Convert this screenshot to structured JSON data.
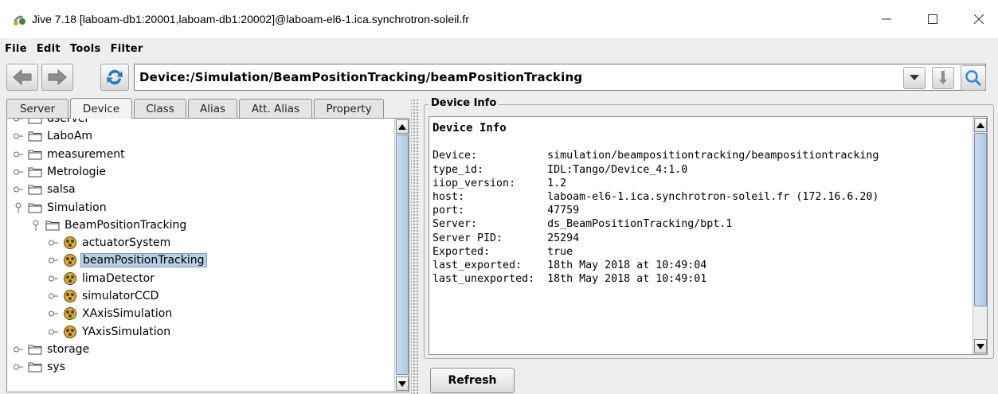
{
  "window": {
    "title": "Jive 7.18 [laboam-db1:20001,laboam-db1:20002]@laboam-el6-1.ica.synchrotron-soleil.fr",
    "controls": [
      "minimize",
      "maximize",
      "close"
    ]
  },
  "menu": [
    "File",
    "Edit",
    "Tools",
    "Filter"
  ],
  "toolbar": {
    "path": "Device:/Simulation/BeamPositionTracking/beamPositionTracking",
    "icons": [
      "back-arrow-icon",
      "forward-arrow-icon",
      "refresh-icon",
      "dropdown-arrow-icon",
      "go-down-icon",
      "search-icon"
    ]
  },
  "tabs": [
    "Server",
    "Device",
    "Class",
    "Alias",
    "Att. Alias",
    "Property"
  ],
  "active_tab": "Device",
  "tree": [
    {
      "label": "dserver",
      "type": "folder",
      "level": 0
    },
    {
      "label": "LaboAm",
      "type": "folder",
      "level": 0
    },
    {
      "label": "measurement",
      "type": "folder",
      "level": 0
    },
    {
      "label": "Metrologie",
      "type": "folder",
      "level": 0
    },
    {
      "label": "salsa",
      "type": "folder",
      "level": 0
    },
    {
      "label": "Simulation",
      "type": "folder",
      "level": 0,
      "expanded": true
    },
    {
      "label": "BeamPositionTracking",
      "type": "folder",
      "level": 1,
      "expanded": true
    },
    {
      "label": "actuatorSystem",
      "type": "device",
      "level": 2
    },
    {
      "label": "beamPositionTracking",
      "type": "device",
      "level": 2,
      "selected": true
    },
    {
      "label": "limaDetector",
      "type": "device",
      "level": 2
    },
    {
      "label": "simulatorCCD",
      "type": "device",
      "level": 2
    },
    {
      "label": "XAxisSimulation",
      "type": "device",
      "level": 2
    },
    {
      "label": "YAxisSimulation",
      "type": "device",
      "level": 2
    },
    {
      "label": "storage",
      "type": "folder",
      "level": 0
    },
    {
      "label": "sys",
      "type": "folder",
      "level": 0
    }
  ],
  "device_info": {
    "group_title": "Device Info",
    "heading": "Device Info",
    "fields": [
      {
        "key": "Device:",
        "value": "simulation/beampositiontracking/beampositiontracking"
      },
      {
        "key": "type_id:",
        "value": "IDL:Tango/Device_4:1.0"
      },
      {
        "key": "iiop_version:",
        "value": "1.2"
      },
      {
        "key": "host:",
        "value": "laboam-el6-1.ica.synchrotron-soleil.fr (172.16.6.20)"
      },
      {
        "key": "port:",
        "value": "47759"
      },
      {
        "key": "Server:",
        "value": "ds_BeamPositionTracking/bpt.1"
      },
      {
        "key": "Server PID:",
        "value": "25294"
      },
      {
        "key": "Exported:",
        "value": "true"
      },
      {
        "key": "last_exported:",
        "value": "18th May 2018 at 10:49:04"
      },
      {
        "key": "last_unexported:",
        "value": "18th May 2018 at 10:49:01"
      }
    ]
  },
  "refresh_label": "Refresh",
  "colors": {
    "selection": "#b8cfe5",
    "scroll_thumb": "#bcd0e8",
    "refresh_icon": "#1f78c8"
  }
}
